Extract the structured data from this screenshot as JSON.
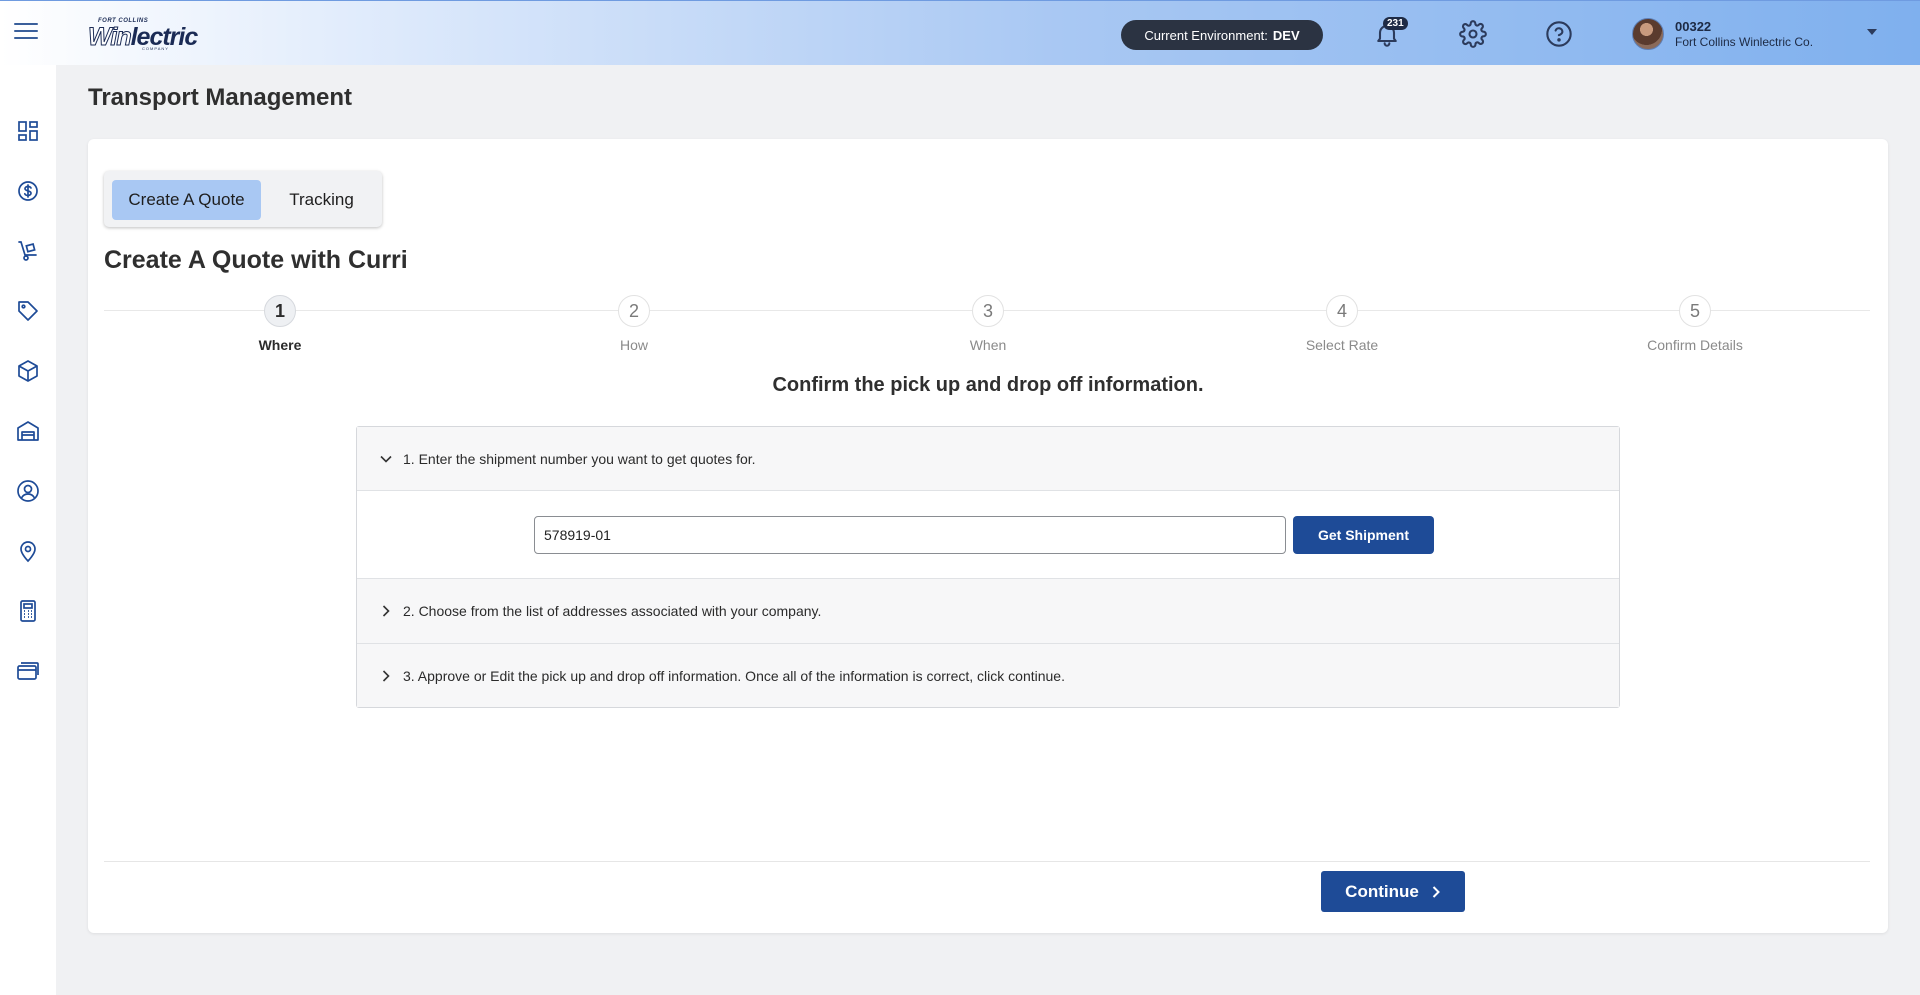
{
  "header": {
    "logo": {
      "top": "FORT COLLINS",
      "name_prefix": "Win",
      "name_suffix": "lectric",
      "sub": "COMPANY"
    },
    "environment_label": "Current Environment:",
    "environment_value": "DEV",
    "notification_count": "231",
    "user_id": "00322",
    "company": "Fort Collins Winlectric Co."
  },
  "sidebar": {
    "items": [
      {
        "icon": "dashboard-icon"
      },
      {
        "icon": "dollar-icon"
      },
      {
        "icon": "hand-truck-icon"
      },
      {
        "icon": "tag-icon"
      },
      {
        "icon": "package-icon"
      },
      {
        "icon": "warehouse-icon"
      },
      {
        "icon": "user-circle-icon"
      },
      {
        "icon": "location-pin-icon"
      },
      {
        "icon": "calculator-icon"
      },
      {
        "icon": "cards-icon"
      }
    ]
  },
  "page": {
    "title": "Transport Management",
    "tabs": [
      {
        "label": "Create A Quote",
        "active": true
      },
      {
        "label": "Tracking",
        "active": false
      }
    ],
    "section_title": "Create A Quote with Curri",
    "steps": [
      {
        "number": "1",
        "label": "Where",
        "active": true
      },
      {
        "number": "2",
        "label": "How",
        "active": false
      },
      {
        "number": "3",
        "label": "When",
        "active": false
      },
      {
        "number": "4",
        "label": "Select Rate",
        "active": false
      },
      {
        "number": "5",
        "label": "Confirm Details",
        "active": false
      }
    ],
    "instruction": "Confirm the pick up and drop off information.",
    "accordion": [
      {
        "label": "1. Enter the shipment number you want to get quotes for.",
        "expanded": true
      },
      {
        "label": "2. Choose from the list of addresses associated with your company.",
        "expanded": false
      },
      {
        "label": "3. Approve or Edit the pick up and drop off information. Once all of the information is correct, click continue.",
        "expanded": false
      }
    ],
    "shipment_number": "578919-01",
    "get_shipment_label": "Get Shipment",
    "continue_label": "Continue"
  },
  "colors": {
    "primary_button": "#1e4b97",
    "active_tab": "#a9c8f3",
    "env_pill": "#2b3342"
  }
}
